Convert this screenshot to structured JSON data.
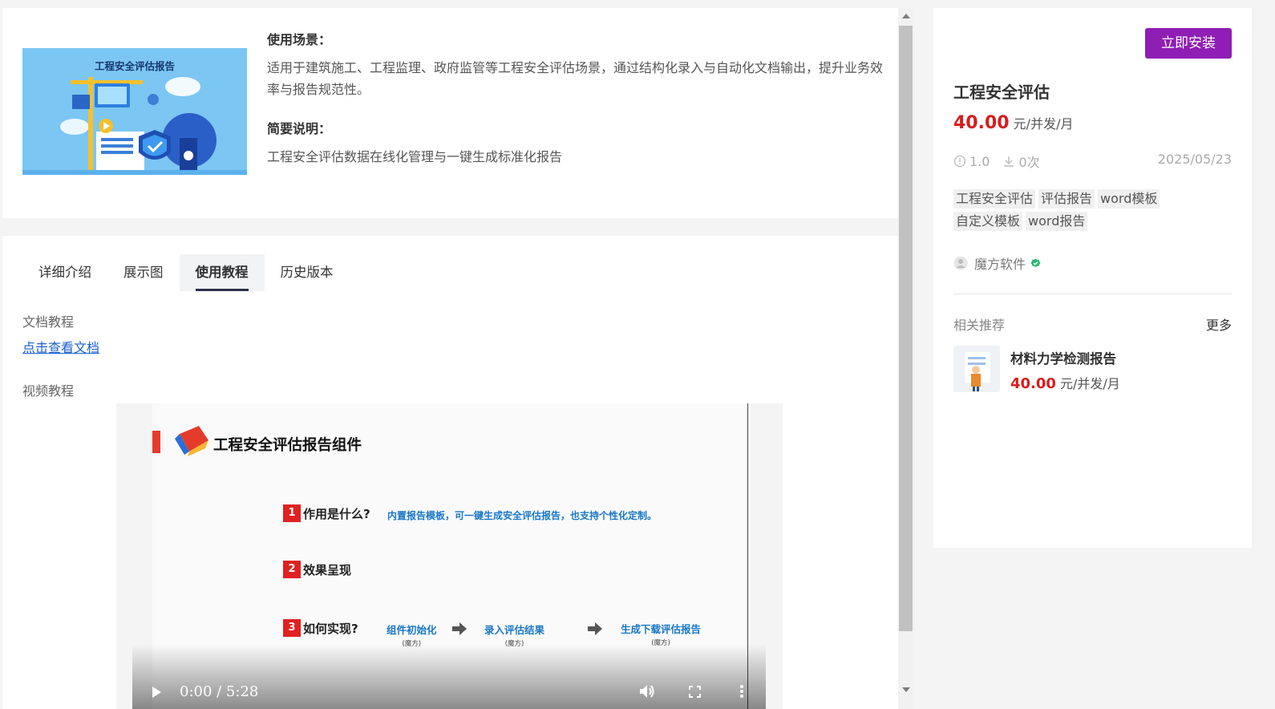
{
  "product_card": {
    "thumbnail_title": "工程安全评估报告",
    "scenario_heading": "使用场景：",
    "scenario_text": "适用于建筑施工、工程监理、政府监管等工程安全评估场景，通过结构化录入与自动化文档输出，提升业务效率与报告规范性。",
    "summary_heading": "简要说明：",
    "summary_text": "工程安全评估数据在线化管理与一键生成标准化报告"
  },
  "tabs": [
    {
      "label": "详细介绍",
      "active": false
    },
    {
      "label": "展示图",
      "active": false
    },
    {
      "label": "使用教程",
      "active": true
    },
    {
      "label": "历史版本",
      "active": false
    }
  ],
  "tutorial": {
    "doc_label": "文档教程",
    "doc_link": "点击查看文档",
    "video_label": "视频教程"
  },
  "video": {
    "slide_title": "工程安全评估报告组件",
    "items": [
      {
        "num": "1",
        "question": "作用是什么?",
        "answer": "内置报告模板，可一键生成安全评估报告，也支持个性化定制。"
      },
      {
        "num": "2",
        "question": "效果呈现",
        "answer": ""
      },
      {
        "num": "3",
        "question": "如何实现?",
        "answer": ""
      }
    ],
    "steps": [
      {
        "title": "组件初始化",
        "sub": "(魔方)"
      },
      {
        "title": "录入评估结果",
        "sub": "(魔方)"
      },
      {
        "title": "生成下载评估报告",
        "sub": "(魔方)"
      }
    ],
    "time": "0:00 / 5:28"
  },
  "sidebar": {
    "install_label": "立即安装",
    "title": "工程安全评估",
    "price": "40.00",
    "price_unit": " 元/并发/月",
    "version": "1.0",
    "downloads": "0次",
    "date": "2025/05/23",
    "tags": [
      "工程安全评估",
      "评估报告",
      "word模板",
      "自定义模板",
      "word报告"
    ],
    "author": "魔方软件",
    "related_title": "相关推荐",
    "more_label": "更多",
    "related": [
      {
        "name": "材料力学检测报告",
        "price": "40.00",
        "unit": " 元/并发/月"
      }
    ]
  },
  "colors": {
    "accent_purple": "#8f1eb4",
    "price_red": "#d71d1d",
    "link_blue": "#1a5fd1"
  }
}
